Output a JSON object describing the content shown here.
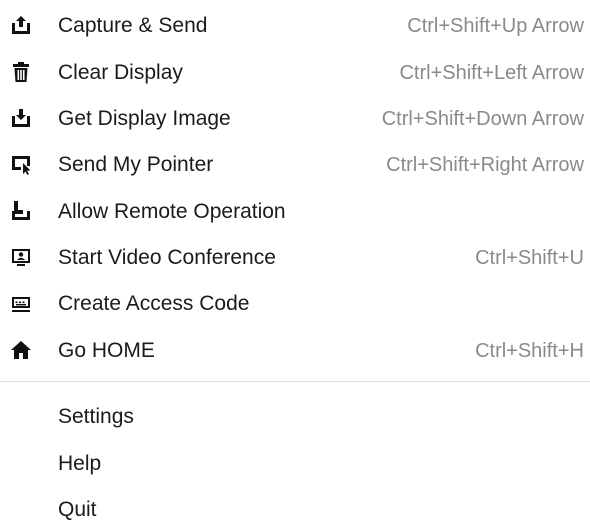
{
  "menu": {
    "items": [
      {
        "label": "Capture & Send",
        "shortcut": "Ctrl+Shift+Up Arrow",
        "icon": "upload-tray-icon"
      },
      {
        "label": "Clear Display",
        "shortcut": "Ctrl+Shift+Left Arrow",
        "icon": "trash-icon"
      },
      {
        "label": "Get Display Image",
        "shortcut": "Ctrl+Shift+Down Arrow",
        "icon": "download-tray-icon"
      },
      {
        "label": "Send My Pointer",
        "shortcut": "Ctrl+Shift+Right Arrow",
        "icon": "pointer-screen-icon"
      },
      {
        "label": "Allow Remote Operation",
        "shortcut": "",
        "icon": "remote-operation-icon"
      },
      {
        "label": "Start Video Conference",
        "shortcut": "Ctrl+Shift+U",
        "icon": "video-conference-icon"
      },
      {
        "label": "Create Access Code",
        "shortcut": "",
        "icon": "keyboard-icon"
      },
      {
        "label": "Go HOME",
        "shortcut": "Ctrl+Shift+H",
        "icon": "home-icon"
      }
    ],
    "secondary_items": [
      {
        "label": "Settings"
      },
      {
        "label": "Help"
      },
      {
        "label": "Quit"
      }
    ]
  },
  "colors": {
    "text": "#1b1b1b",
    "shortcut_text": "#8a8a8a",
    "divider": "#dcdcdc",
    "background": "#ffffff"
  }
}
